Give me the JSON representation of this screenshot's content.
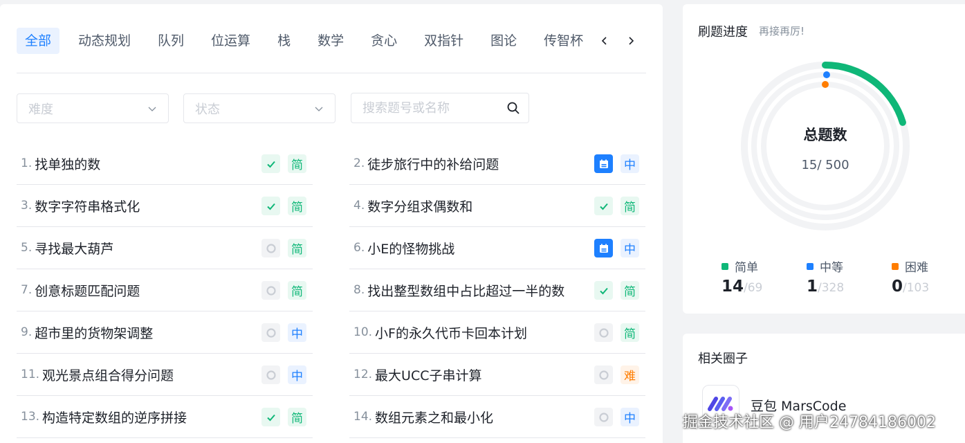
{
  "tabs": {
    "items": [
      "全部",
      "动态规划",
      "队列",
      "位运算",
      "栈",
      "数学",
      "贪心",
      "双指针",
      "图论",
      "传智杯"
    ],
    "active_index": 0
  },
  "filters": {
    "difficulty_placeholder": "难度",
    "status_placeholder": "状态",
    "search_placeholder": "搜索题号或名称"
  },
  "problems": [
    {
      "num": "1.",
      "title": "找单独的数",
      "status": "done",
      "difficulty": "简",
      "diff_class": "easy"
    },
    {
      "num": "2.",
      "title": "徒步旅行中的补给问题",
      "status": "calendar",
      "difficulty": "中",
      "diff_class": "mid"
    },
    {
      "num": "3.",
      "title": "数字字符串格式化",
      "status": "done",
      "difficulty": "简",
      "diff_class": "easy"
    },
    {
      "num": "4.",
      "title": "数字分组求偶数和",
      "status": "done",
      "difficulty": "简",
      "diff_class": "easy"
    },
    {
      "num": "5.",
      "title": "寻找最大葫芦",
      "status": "todo",
      "difficulty": "简",
      "diff_class": "easy"
    },
    {
      "num": "6.",
      "title": "小E的怪物挑战",
      "status": "calendar",
      "difficulty": "中",
      "diff_class": "mid"
    },
    {
      "num": "7.",
      "title": "创意标题匹配问题",
      "status": "todo",
      "difficulty": "简",
      "diff_class": "easy"
    },
    {
      "num": "8.",
      "title": "找出整型数组中占比超过一半的数",
      "status": "done",
      "difficulty": "简",
      "diff_class": "easy"
    },
    {
      "num": "9.",
      "title": "超市里的货物架调整",
      "status": "todo",
      "difficulty": "中",
      "diff_class": "mid"
    },
    {
      "num": "10.",
      "title": "小F的永久代币卡回本计划",
      "status": "todo",
      "difficulty": "简",
      "diff_class": "easy"
    },
    {
      "num": "11.",
      "title": "观光景点组合得分问题",
      "status": "todo",
      "difficulty": "中",
      "diff_class": "mid"
    },
    {
      "num": "12.",
      "title": "最大UCC子串计算",
      "status": "todo",
      "difficulty": "难",
      "diff_class": "hard"
    },
    {
      "num": "13.",
      "title": "构造特定数组的逆序拼接",
      "status": "done",
      "difficulty": "简",
      "diff_class": "easy"
    },
    {
      "num": "14.",
      "title": "数组元素之和最小化",
      "status": "todo",
      "difficulty": "中",
      "diff_class": "mid"
    }
  ],
  "progress": {
    "title": "刷题进度",
    "subtitle": "再接再厉!",
    "center_label": "总题数",
    "count_text": "15/ 500",
    "total_solved": 15,
    "total": 500,
    "stats": [
      {
        "label": "简单",
        "solved": "14",
        "total": "/69",
        "color": "#0fb778"
      },
      {
        "label": "中等",
        "solved": "1",
        "total": "/328",
        "color": "#1e80ff"
      },
      {
        "label": "困难",
        "solved": "0",
        "total": "/103",
        "color": "#ff7d00"
      }
    ]
  },
  "circle": {
    "title": "相关圈子",
    "name": "豆包 MarsCode"
  },
  "watermark": "掘金技术社区 @ 用户24784186002",
  "colors": {
    "accent": "#1e80ff",
    "easy": "#0fb778",
    "medium": "#1e80ff",
    "hard": "#ff7d00"
  }
}
